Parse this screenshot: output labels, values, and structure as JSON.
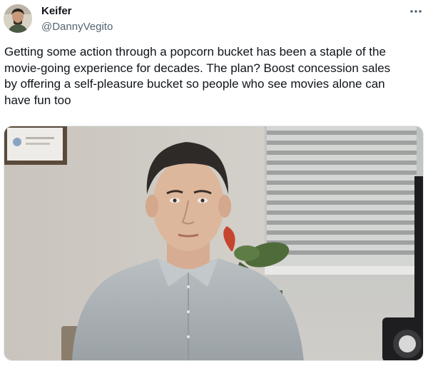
{
  "tweet": {
    "author": {
      "display_name": "Keifer",
      "handle": "@DannyVegito",
      "avatar_icon": "user-avatar"
    },
    "more_icon": "more-horizontal-icon",
    "text_lines": [
      "Getting some action through a popcorn bucket has been a staple of the",
      "movie-going experience for decades. The plan? Boost concession sales",
      "by offering a self-pleasure bucket so people who see movies alone can",
      "have fun too"
    ],
    "media": {
      "kind": "photo",
      "subject": "man in grey button-down shirt in an office"
    }
  },
  "colors": {
    "text_primary": "#0f1419",
    "text_secondary": "#536471",
    "media_border": "#e1e8ed"
  }
}
